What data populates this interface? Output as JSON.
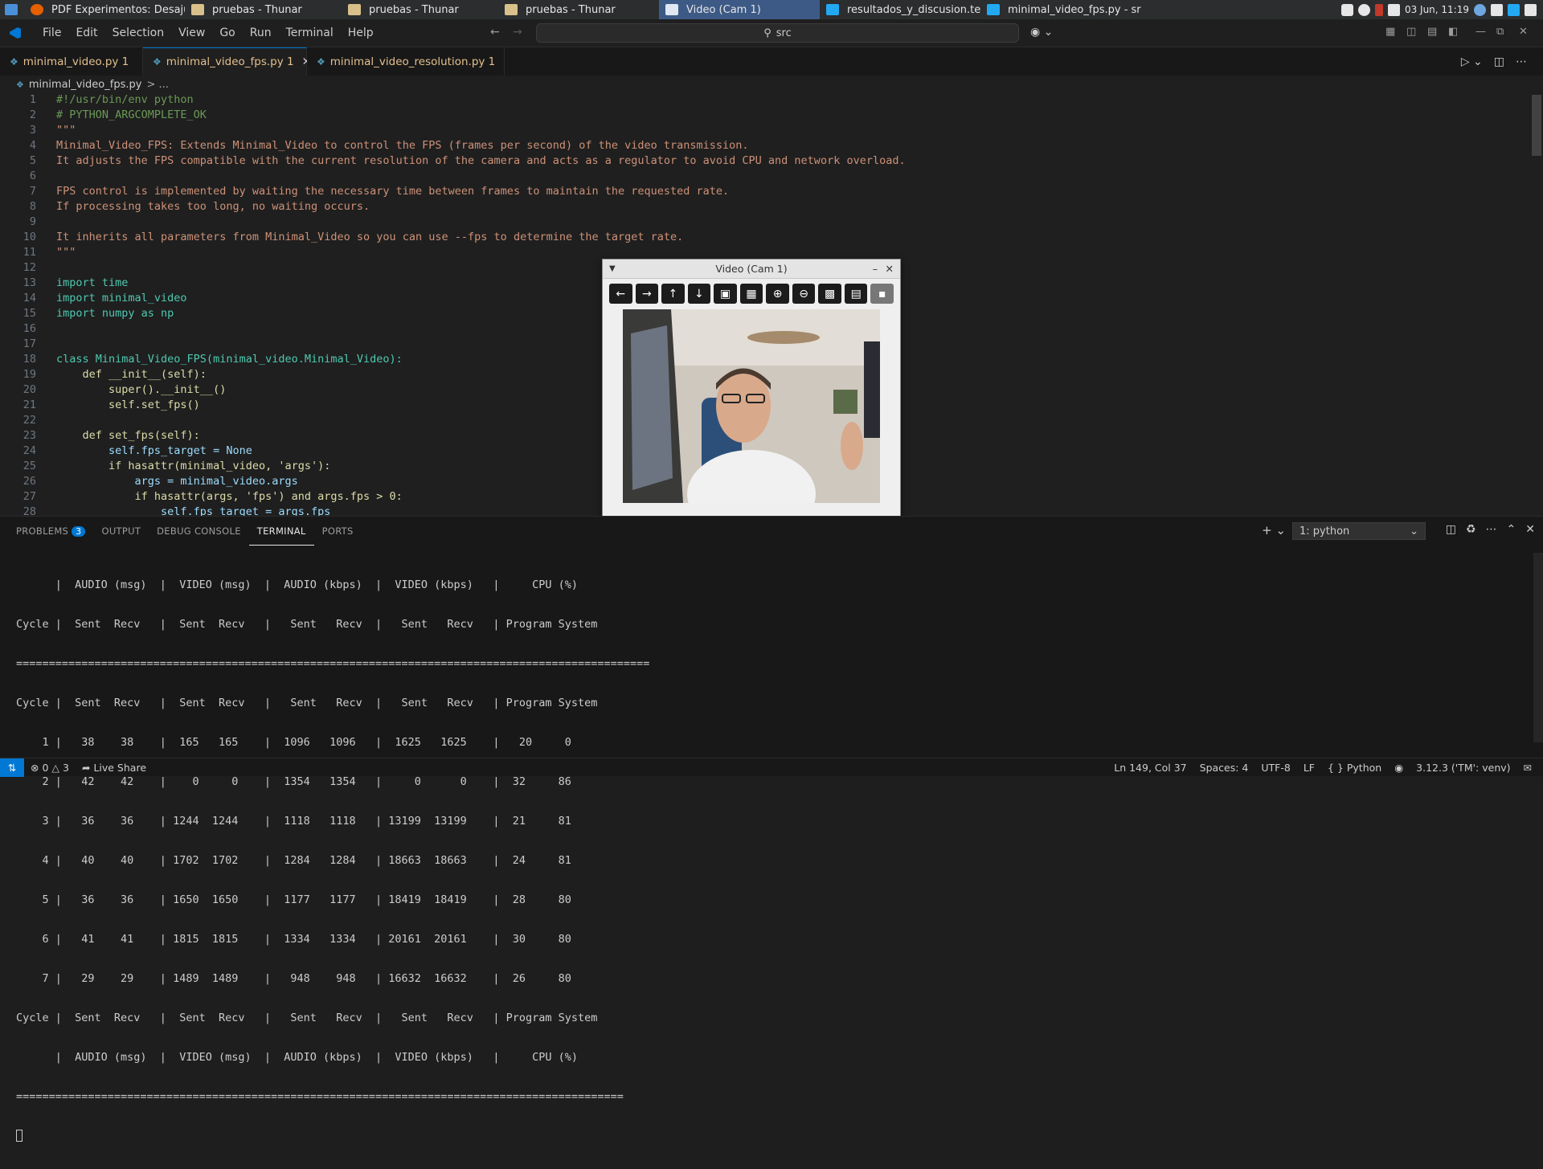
{
  "taskbar": {
    "items": [
      {
        "label": "PDF Experimentos: Desajust..."
      },
      {
        "label": "pruebas - Thunar"
      },
      {
        "label": "pruebas - Thunar"
      },
      {
        "label": "pruebas - Thunar"
      },
      {
        "label": "Video (Cam 1)"
      },
      {
        "label": "resultados_y_discusion.tex - ..."
      },
      {
        "label": "minimal_video_fps.py - src - ..."
      }
    ],
    "clock": "03 Jun, 11:19"
  },
  "menu": {
    "items": [
      "File",
      "Edit",
      "Selection",
      "View",
      "Go",
      "Run",
      "Terminal",
      "Help"
    ],
    "search": "src"
  },
  "tabs": [
    {
      "label": "minimal_video.py 1",
      "active": false
    },
    {
      "label": "minimal_video_fps.py 1",
      "active": true
    },
    {
      "label": "minimal_video_resolution.py 1",
      "active": false
    }
  ],
  "breadcrumb": {
    "file": "minimal_video_fps.py",
    "rest": "> ..."
  },
  "code": [
    {
      "n": "1",
      "t": "#!/usr/bin/env python"
    },
    {
      "n": "2",
      "t": "# PYTHON_ARGCOMPLETE_OK"
    },
    {
      "n": "3",
      "t": "\"\"\""
    },
    {
      "n": "4",
      "t": "Minimal_Video_FPS: Extends Minimal_Video to control the FPS (frames per second) of the video transmission."
    },
    {
      "n": "5",
      "t": "It adjusts the FPS compatible with the current resolution of the camera and acts as a regulator to avoid CPU and network overload."
    },
    {
      "n": "6",
      "t": ""
    },
    {
      "n": "7",
      "t": "FPS control is implemented by waiting the necessary time between frames to maintain the requested rate."
    },
    {
      "n": "8",
      "t": "If processing takes too long, no waiting occurs."
    },
    {
      "n": "9",
      "t": ""
    },
    {
      "n": "10",
      "t": "It inherits all parameters from Minimal_Video so you can use --fps to determine the target rate."
    },
    {
      "n": "11",
      "t": "\"\"\""
    },
    {
      "n": "12",
      "t": ""
    },
    {
      "n": "13",
      "t": "import time"
    },
    {
      "n": "14",
      "t": "import minimal_video"
    },
    {
      "n": "15",
      "t": "import numpy as np"
    },
    {
      "n": "16",
      "t": ""
    },
    {
      "n": "17",
      "t": ""
    },
    {
      "n": "18",
      "t": "class Minimal_Video_FPS(minimal_video.Minimal_Video):"
    },
    {
      "n": "19",
      "t": "    def __init__(self):"
    },
    {
      "n": "20",
      "t": "        super().__init__()"
    },
    {
      "n": "21",
      "t": "        self.set_fps()"
    },
    {
      "n": "22",
      "t": ""
    },
    {
      "n": "23",
      "t": "    def set_fps(self):"
    },
    {
      "n": "24",
      "t": "        self.fps_target = None"
    },
    {
      "n": "25",
      "t": "        if hasattr(minimal_video, 'args'):"
    },
    {
      "n": "26",
      "t": "            args = minimal_video.args"
    },
    {
      "n": "27",
      "t": "            if hasattr(args, 'fps') and args.fps > 0:"
    },
    {
      "n": "28",
      "t": "                self.fps_target = args.fps"
    }
  ],
  "video_window": {
    "title": "Video (Cam 1)"
  },
  "panel": {
    "tabs": [
      "PROBLEMS",
      "OUTPUT",
      "DEBUG CONSOLE",
      "TERMINAL",
      "PORTS"
    ],
    "problems_count": "3",
    "terminal_name": "1: python",
    "terminal_lines": [
      "      |  AUDIO (msg)  |  VIDEO (msg)  |  AUDIO (kbps)  |  VIDEO (kbps)   |     CPU (%)",
      "Cycle |  Sent  Recv   |  Sent  Recv   |   Sent   Recv  |   Sent   Recv   | Program System",
      "=================================================================================================",
      "Cycle |  Sent  Recv   |  Sent  Recv   |   Sent   Recv  |   Sent   Recv   | Program System",
      "    1 |   38    38    |  165   165    |  1096   1096   |  1625   1625    |   20     0",
      "    2 |   42    42    |    0     0    |  1354   1354   |     0      0    |  32     86",
      "    3 |   36    36    | 1244  1244    |  1118   1118   | 13199  13199    |  21     81",
      "    4 |   40    40    | 1702  1702    |  1284   1284   | 18663  18663    |  24     81",
      "    5 |   36    36    | 1650  1650    |  1177   1177   | 18419  18419    |  28     80",
      "    6 |   41    41    | 1815  1815    |  1334   1334   | 20161  20161    |  30     80",
      "    7 |   29    29    | 1489  1489    |   948    948   | 16632  16632    |  26     80",
      "Cycle |  Sent  Recv   |  Sent  Recv   |   Sent   Recv  |   Sent   Recv   | Program System",
      "      |  AUDIO (msg)  |  VIDEO (msg)  |  AUDIO (kbps)  |  VIDEO (kbps)   |     CPU (%)",
      "============================================================================================="
    ]
  },
  "status": {
    "errors": "0",
    "warnings": "3",
    "live_share": "Live Share",
    "position": "Ln 149, Col 37",
    "spaces": "Spaces: 4",
    "encoding": "UTF-8",
    "eol": "LF",
    "language": "Python",
    "interpreter": "3.12.3 ('TM': venv)"
  },
  "colors": {
    "accent": "#0078d4",
    "modified_tab": "#e2c08d",
    "string": "#ce9178",
    "keyword": "#c586c0",
    "type": "#4ec9b0"
  }
}
